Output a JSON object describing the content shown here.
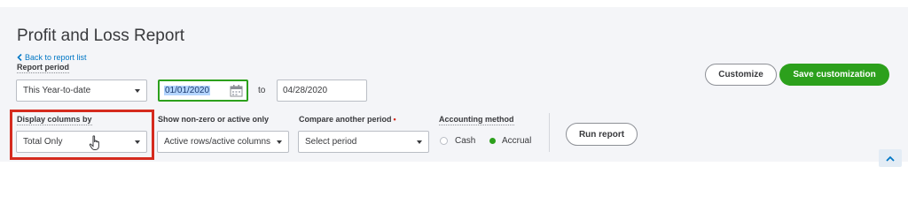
{
  "page_title": "Profit and Loss Report",
  "back_link": "Back to report list",
  "report_period": {
    "label": "Report period",
    "selected": "This Year-to-date",
    "from_date": "01/01/2020",
    "to_label": "to",
    "to_date": "04/28/2020"
  },
  "display_columns": {
    "label": "Display columns by",
    "selected": "Total Only"
  },
  "show_rows": {
    "label": "Show non-zero or active only",
    "selected": "Active rows/active columns"
  },
  "compare": {
    "label": "Compare another period",
    "required_mark": "•",
    "placeholder": "Select period"
  },
  "accounting_method": {
    "label": "Accounting method",
    "options": [
      "Cash",
      "Accrual"
    ],
    "selected": "Accrual"
  },
  "buttons": {
    "run_report": "Run report",
    "customize": "Customize",
    "save_customization": "Save customization"
  },
  "colors": {
    "accent_green": "#2ca01c",
    "link_blue": "#0077c5",
    "highlight_red": "#d52b1e",
    "panel_bg": "#f4f5f8"
  },
  "icons": [
    "chevron-left-icon",
    "calendar-icon",
    "caret-down-icon",
    "hand-cursor-icon",
    "chevron-up-icon"
  ]
}
